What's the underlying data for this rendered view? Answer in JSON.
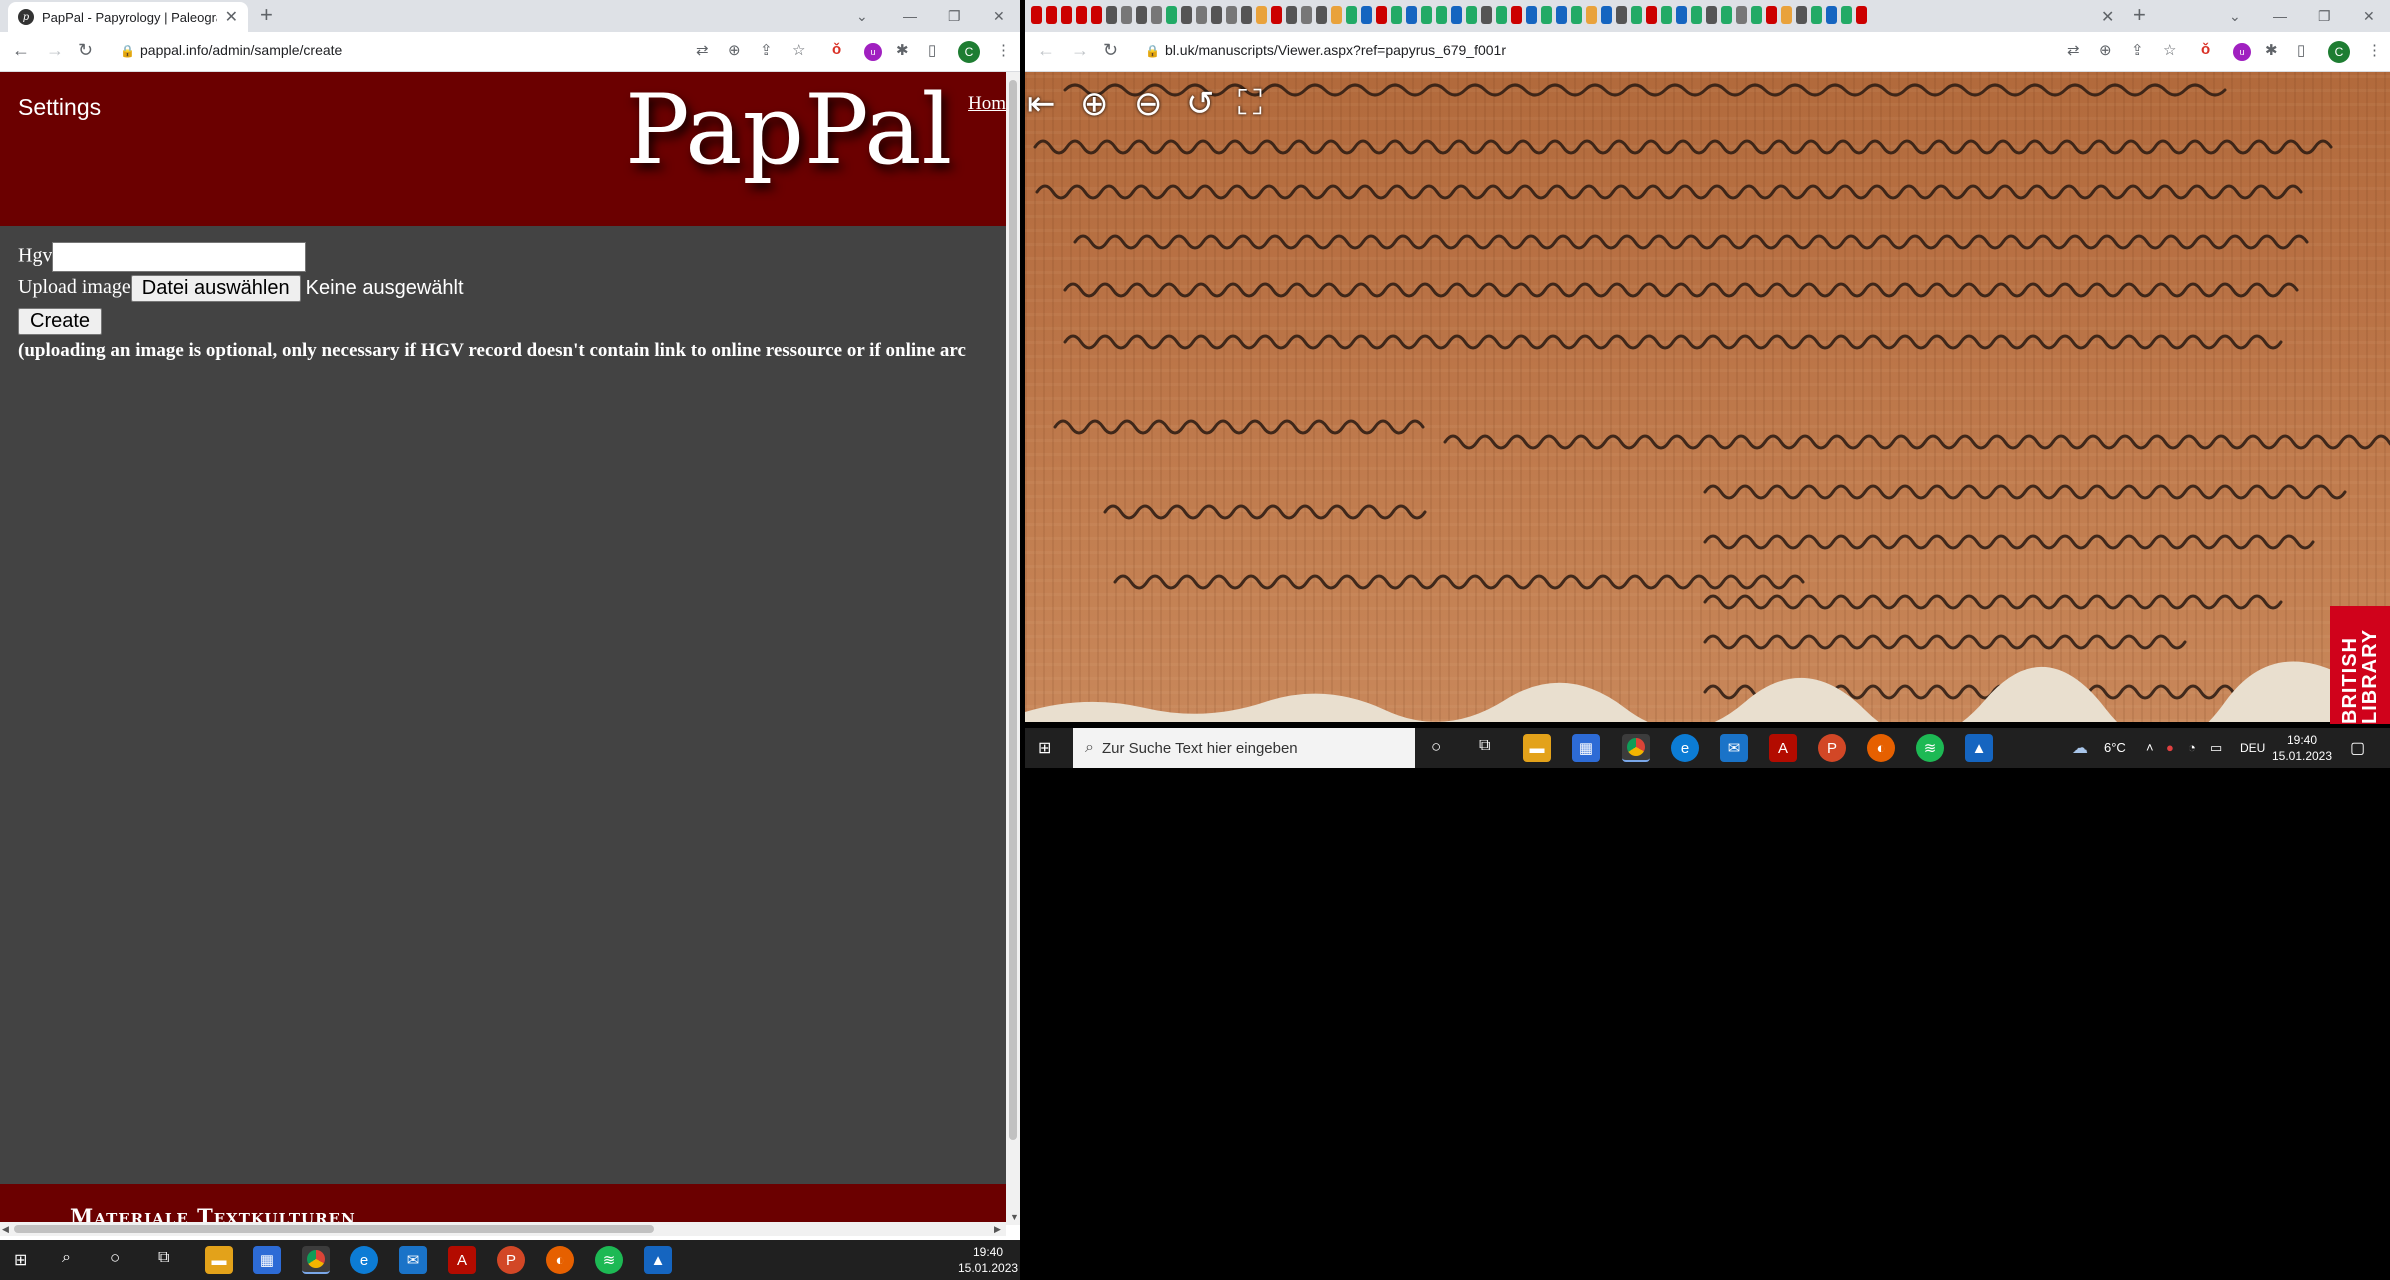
{
  "left_browser": {
    "tab_title": "PapPal - Papyrology | Paleograph",
    "url": "pappal.info/admin/sample/create",
    "profile_initial": "C"
  },
  "page": {
    "nav_title": "Settings",
    "logo_text": "PapPal",
    "home_link": "Hom",
    "form": {
      "hgv_label": "Hgv",
      "upload_label": "Upload image",
      "choose_file_button": "Datei auswählen",
      "no_file_text": "Keine ausgewählt",
      "create_button": "Create",
      "note": "(uploading an image is optional, only necessary if HGV record doesn't contain link to online ressource or if online arc"
    },
    "footer_text": "Materiale Textkulturen"
  },
  "left_taskbar": {
    "time": "19:40",
    "date": "15.01.2023"
  },
  "right_browser": {
    "url": "bl.uk/manuscripts/Viewer.aspx?ref=papyrus_679_f001r",
    "profile_initial": "C",
    "viewer_tools": [
      "exit-icon",
      "zoom-in-icon",
      "zoom-out-icon",
      "rotate-icon",
      "fullscreen-icon"
    ],
    "badge_text": "BRITISH LIBRARY"
  },
  "right_taskbar": {
    "search_placeholder": "Zur Suche Text hier eingeben",
    "weather": "6°C",
    "language": "DEU",
    "time": "19:40",
    "date": "15.01.2023"
  },
  "colors": {
    "header": "#6b0000",
    "page_bg": "#434343",
    "taskbar": "#202020"
  }
}
